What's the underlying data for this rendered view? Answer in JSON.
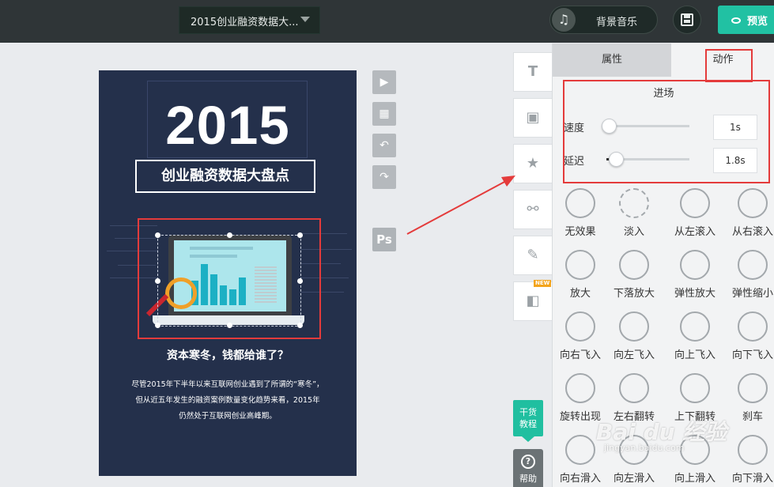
{
  "topbar": {
    "title_select": "2015创业融资数据大...",
    "music_label": "背景音乐",
    "preview_label": "预览",
    "music_icon": "music-note-icon",
    "save_icon": "save-icon",
    "preview_icon": "eye-icon"
  },
  "canvas": {
    "year": "2015",
    "subtitle": "创业融资数据大盘点",
    "question": "资本寒冬，钱都给谁了？",
    "body_lines": [
      "尽管2015年下半年以来互联网创业遇到了所谓的“寒冬”，",
      "但从近五年发生的融资案例数量变化趋势来看，2015年",
      "仍然处于互联网创业高峰期。"
    ],
    "chart_bars": [
      32,
      54,
      40,
      26,
      21,
      36
    ]
  },
  "mini_tools": [
    {
      "name": "play-icon",
      "glyph": "▶"
    },
    {
      "name": "grid-icon",
      "glyph": "▦"
    },
    {
      "name": "undo-icon",
      "glyph": "↶"
    },
    {
      "name": "redo-icon",
      "glyph": "↷"
    }
  ],
  "ps_label": "Ps",
  "side_tools": [
    {
      "name": "text-tool-icon",
      "glyph": "T"
    },
    {
      "name": "image-tool-icon",
      "glyph": "▣"
    },
    {
      "name": "star-tool-icon",
      "glyph": "★"
    },
    {
      "name": "link-tool-icon",
      "glyph": "⚯"
    },
    {
      "name": "magic-wand-icon",
      "glyph": "✎"
    },
    {
      "name": "widget-tool-icon",
      "glyph": "◧"
    }
  ],
  "new_badge": "NEW",
  "tutorial_lines": [
    "干货",
    "教程"
  ],
  "help_label": "帮助",
  "panel": {
    "tab_attr": "属性",
    "tab_action": "动作",
    "section_title": "进场",
    "speed_label": "速度",
    "speed_value": "1s",
    "speed_level": 0.0,
    "delay_label": "延迟",
    "delay_value": "1.8s",
    "delay_level": 0.09,
    "effects": [
      "无效果",
      "淡入",
      "从左滚入",
      "从右滚入",
      "放大",
      "下落放大",
      "弹性放大",
      "弹性缩小",
      "向右飞入",
      "向左飞入",
      "向上飞入",
      "向下飞入",
      "旋转出现",
      "左右翻转",
      "上下翻转",
      "刹车",
      "向右滑入",
      "向左滑入",
      "向上滑入",
      "向下滑入"
    ]
  },
  "watermark": {
    "main": "Bai du 经验",
    "sub": "jingyan.baidu.com"
  },
  "colors": {
    "accent": "#21c1a3",
    "highlight_red": "#e43b3b",
    "canvas_bg": "#24304b"
  }
}
